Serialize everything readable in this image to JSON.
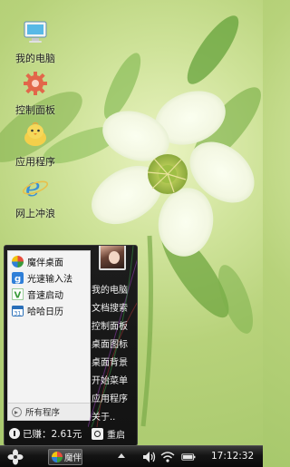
{
  "desktop": {
    "icons": [
      {
        "label": "我的电脑",
        "icon": "computer-icon"
      },
      {
        "label": "控制面板",
        "icon": "gear-icon"
      },
      {
        "label": "应用程序",
        "icon": "chick-icon"
      },
      {
        "label": "网上冲浪",
        "icon": "ie-browser-icon"
      }
    ]
  },
  "start_menu": {
    "apps": [
      {
        "label": "魔伴桌面",
        "icon": "pinwheel-icon",
        "color": "#e74c3c"
      },
      {
        "label": "光速输入法",
        "icon": "g-input-icon",
        "color": "#2f7fd8"
      },
      {
        "label": "音速启动",
        "icon": "v-launcher-icon",
        "color": "#3a9b3a"
      },
      {
        "label": "哈哈日历",
        "icon": "calendar-icon",
        "color": "#2a6fb8"
      }
    ],
    "all_programs": "所有程序",
    "right_items": [
      "我的电脑",
      "文档搜索",
      "控制面板",
      "桌面图标",
      "桌面背景",
      "开始菜单",
      "应用程序",
      "关于.."
    ],
    "earned": "已赚：2.61元",
    "restart": "重启"
  },
  "taskbar": {
    "task_label": "魔伴",
    "clock": "17:12:32"
  },
  "colors": {
    "wallpaper_green": "#b7d27a",
    "menu_dark": "#121212",
    "taskbar_dark": "#141414"
  }
}
